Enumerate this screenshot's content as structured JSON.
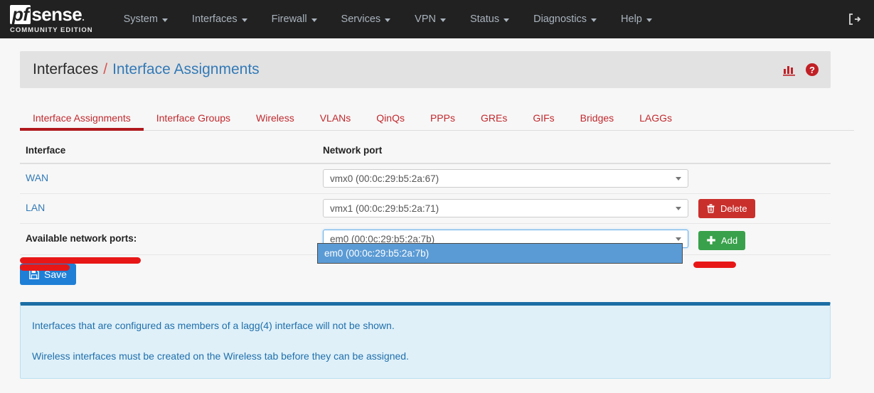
{
  "navbar": {
    "brand": {
      "pf": "pf",
      "sense": "sense",
      "dot": ".",
      "subtitle": "COMMUNITY EDITION"
    },
    "menu": [
      {
        "label": "System",
        "icon": "chevron-down-icon"
      },
      {
        "label": "Interfaces",
        "icon": "chevron-down-icon"
      },
      {
        "label": "Firewall",
        "icon": "chevron-down-icon"
      },
      {
        "label": "Services",
        "icon": "chevron-down-icon"
      },
      {
        "label": "VPN",
        "icon": "chevron-down-icon"
      },
      {
        "label": "Status",
        "icon": "chevron-down-icon"
      },
      {
        "label": "Diagnostics",
        "icon": "chevron-down-icon"
      },
      {
        "label": "Help",
        "icon": "chevron-down-icon"
      }
    ],
    "logout_icon": "logout-icon"
  },
  "header": {
    "breadcrumb_parent": "Interfaces",
    "breadcrumb_separator": "/",
    "breadcrumb_current": "Interface Assignments",
    "stats_icon": "bar-chart-icon",
    "help_icon": "question-circle-icon"
  },
  "tabs": [
    {
      "label": "Interface Assignments",
      "active": true
    },
    {
      "label": "Interface Groups",
      "active": false
    },
    {
      "label": "Wireless",
      "active": false
    },
    {
      "label": "VLANs",
      "active": false
    },
    {
      "label": "QinQs",
      "active": false
    },
    {
      "label": "PPPs",
      "active": false
    },
    {
      "label": "GREs",
      "active": false
    },
    {
      "label": "GIFs",
      "active": false
    },
    {
      "label": "Bridges",
      "active": false
    },
    {
      "label": "LAGGs",
      "active": false
    }
  ],
  "table": {
    "headers": {
      "interface": "Interface",
      "network_port": "Network port"
    },
    "rows": [
      {
        "interface": "WAN",
        "port_value": "vmx0 (00:0c:29:b5:2a:67)",
        "action": null
      },
      {
        "interface": "LAN",
        "port_value": "vmx1 (00:0c:29:b5:2a:71)",
        "action": "Delete"
      }
    ],
    "available_row": {
      "label": "Available network ports:",
      "port_value": "em0 (00:0c:29:b5:2a:7b)",
      "dropdown_options": [
        "em0 (00:0c:29:b5:2a:7b)"
      ],
      "action": "Add"
    }
  },
  "buttons": {
    "save": "Save",
    "delete": "Delete",
    "add": "Add",
    "save_icon": "floppy-disk-icon",
    "delete_icon": "trash-icon",
    "add_icon": "plus-icon"
  },
  "info_panel": {
    "line1": "Interfaces that are configured as members of a lagg(4) interface will not be shown.",
    "line2": "Wireless interfaces must be created on the Wireless tab before they can be assigned."
  },
  "colors": {
    "navbar_bg": "#212121",
    "accent_red": "#c1292e",
    "link_blue": "#337ab7",
    "delete_red": "#c9302c",
    "add_green": "#39a14b",
    "save_blue": "#1f7fd6",
    "dropdown_highlight": "#5b9bd5",
    "info_bg": "#dff0f9",
    "annotation_red": "#e81717"
  }
}
